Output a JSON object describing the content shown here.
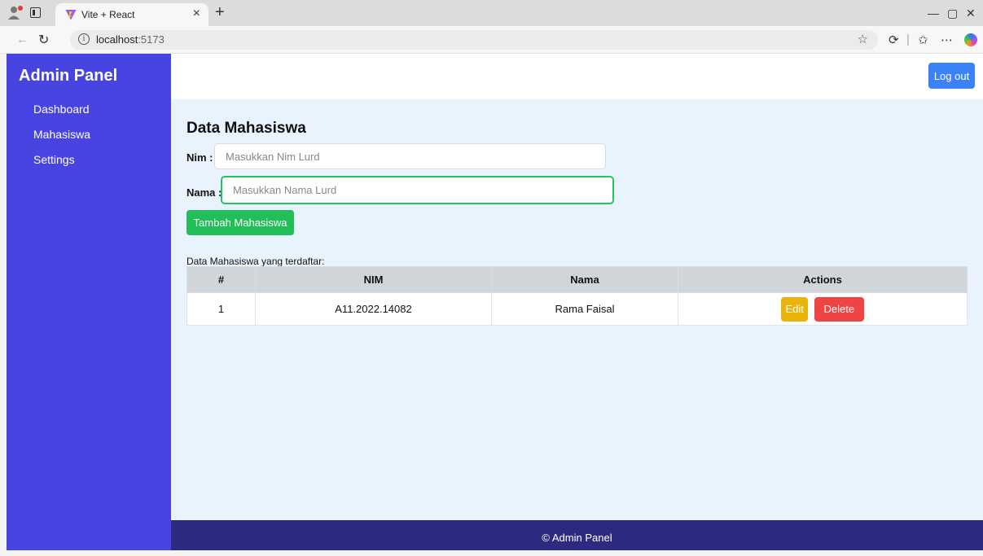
{
  "browser": {
    "tab_title": "Vite + React",
    "url_host": "localhost",
    "url_port": ":5173"
  },
  "sidebar": {
    "brand": "Admin Panel",
    "items": [
      {
        "label": "Dashboard"
      },
      {
        "label": "Mahasiswa"
      },
      {
        "label": "Settings"
      }
    ],
    "bg_color": "#4744e2"
  },
  "header": {
    "logout_label": "Log out"
  },
  "main": {
    "title": "Data Mahasiswa",
    "nim_label": "Nim :",
    "nim_placeholder": "Masukkan Nim Lurd",
    "nama_label": "Nama :",
    "nama_placeholder": "Masukkan Nama Lurd",
    "add_button": "Tambah Mahasiswa",
    "table_caption": "Data Mahasiswa yang terdaftar:",
    "table": {
      "headers": [
        "#",
        "NIM",
        "Nama",
        "Actions"
      ],
      "rows": [
        {
          "no": "1",
          "nim": "A11.2022.14082",
          "nama": "Rama Faisal"
        }
      ],
      "edit_label": "Edit",
      "delete_label": "Delete"
    }
  },
  "footer": {
    "text": "© Admin Panel"
  }
}
